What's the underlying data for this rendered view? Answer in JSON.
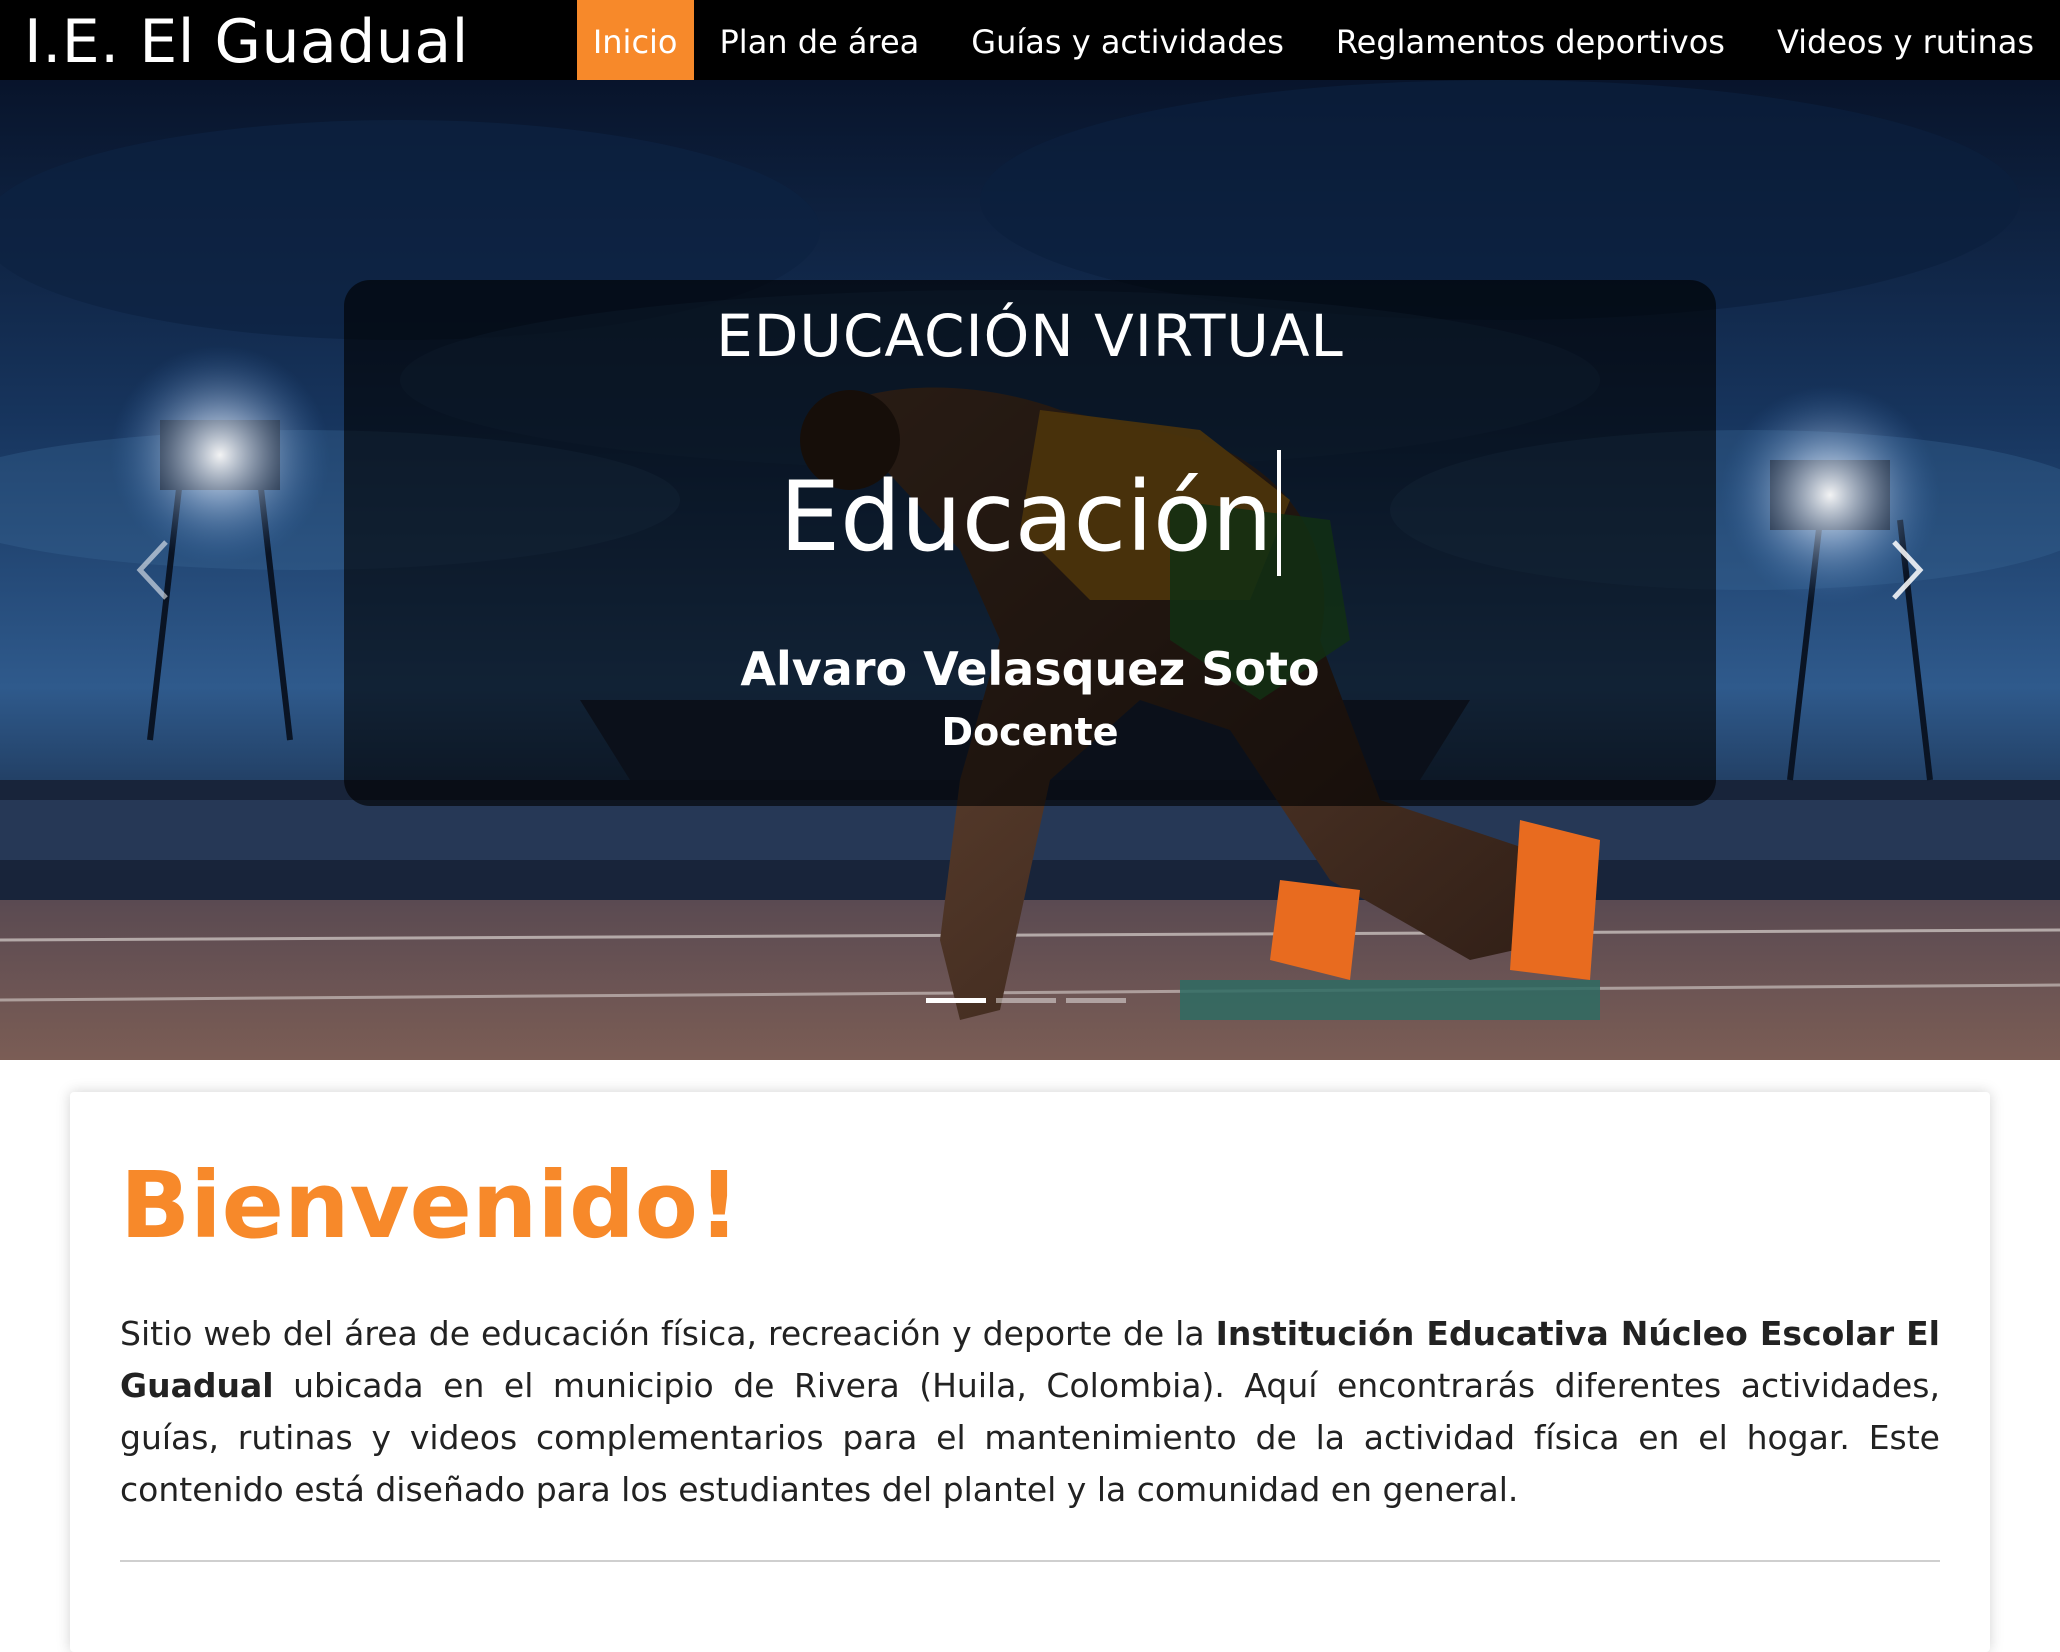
{
  "navbar": {
    "brand": "I.E. El Guadual",
    "links": [
      {
        "label": "Inicio",
        "active": true
      },
      {
        "label": "Plan de área",
        "active": false
      },
      {
        "label": "Guías y actividades",
        "active": false
      },
      {
        "label": "Reglamentos deportivos",
        "active": false
      },
      {
        "label": "Videos y rutinas",
        "active": false
      }
    ]
  },
  "hero": {
    "title": "EDUCACIÓN VIRTUAL",
    "typed_word": "Educación",
    "name": "Alvaro Velasquez Soto",
    "role": "Docente",
    "slide_count": 3,
    "active_slide": 1
  },
  "welcome": {
    "title": "Bienvenido!",
    "text_before": "Sitio web del área de educación física, recreación y deporte de la ",
    "institution": "Institución Educativa Núcleo Escolar El Guadual",
    "text_after": " ubicada en el municipio de Rivera (Huila, Colombia). Aquí encontrarás diferentes actividades, guías, rutinas y videos complementarios para el mantenimiento de la actividad física en el hogar. Este contenido está diseñado para los estudiantes del plantel y la comunidad en general."
  },
  "colors": {
    "accent": "#f7892a",
    "navbar_bg": "#000000"
  },
  "icons": {
    "prev": "chevron-left-icon",
    "next": "chevron-right-icon"
  }
}
